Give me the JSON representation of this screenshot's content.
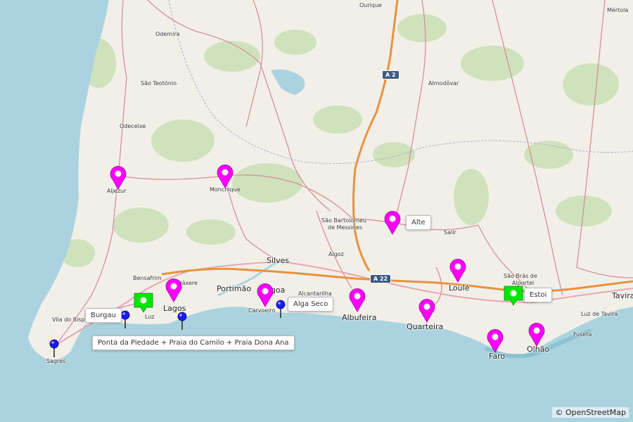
{
  "map": {
    "attribution": "© OpenStreetMap",
    "colors": {
      "sea": "#aad3df",
      "land": "#f2efe9",
      "forest": "#c8e0b3",
      "motorway": "#e8923c",
      "road": "#d68f9c",
      "marker_magenta": "#ff00ff",
      "marker_green": "#00e600",
      "marker_blue": "#1a1aff"
    },
    "towns": [
      {
        "id": "ourique",
        "name": "Ourique"
      },
      {
        "id": "mertola",
        "name": "Mértola"
      },
      {
        "id": "odemira",
        "name": "Odemira"
      },
      {
        "id": "saoteotonio",
        "name": "São Teotónio"
      },
      {
        "id": "almodovar",
        "name": "Almodôvar"
      },
      {
        "id": "odeceixe",
        "name": "Odeceixe"
      },
      {
        "id": "aljezur",
        "name": "Aljezur"
      },
      {
        "id": "monchique",
        "name": "Monchique"
      },
      {
        "id": "saobart1",
        "name": "São Bartolomeu"
      },
      {
        "id": "saobart2",
        "name": "de Messines"
      },
      {
        "id": "salir",
        "name": "Salir"
      },
      {
        "id": "silves",
        "name": "Silves"
      },
      {
        "id": "algoz",
        "name": "Algoz"
      },
      {
        "id": "saobras1",
        "name": "São Brás de"
      },
      {
        "id": "saobras2",
        "name": "Alportel"
      },
      {
        "id": "tavira",
        "name": "Tavira"
      },
      {
        "id": "bensafrim",
        "name": "Bensafrim"
      },
      {
        "id": "odiaxere",
        "name": "Odiáxere"
      },
      {
        "id": "portimao",
        "name": "Portimão"
      },
      {
        "id": "lagoa",
        "name": "Lagoa"
      },
      {
        "id": "alcantarilha",
        "name": "Alcantarilha"
      },
      {
        "id": "loule",
        "name": "Loulé"
      },
      {
        "id": "lagos",
        "name": "Lagos"
      },
      {
        "id": "luz",
        "name": "Luz"
      },
      {
        "id": "vilabispo",
        "name": "Vila do Bispo"
      },
      {
        "id": "carvoeiro",
        "name": "Carvoeiro"
      },
      {
        "id": "albufeira",
        "name": "Albufeira"
      },
      {
        "id": "quarteira",
        "name": "Quarteira"
      },
      {
        "id": "luzdetavira",
        "name": "Luz de Tavira"
      },
      {
        "id": "fuseta",
        "name": "Fuseta"
      },
      {
        "id": "sagres",
        "name": "Sagres"
      },
      {
        "id": "faro",
        "name": "Faro"
      },
      {
        "id": "olhao",
        "name": "Olhão"
      }
    ],
    "road_shields": [
      {
        "id": "a2",
        "label": "A 2"
      },
      {
        "id": "a22",
        "label": "A 22"
      }
    ],
    "callouts": [
      {
        "id": "alte",
        "label": "Alte"
      },
      {
        "id": "estoi",
        "label": "Estoi"
      },
      {
        "id": "burgau",
        "label": "Burgau"
      },
      {
        "id": "algaseco",
        "label": "Alga Seco"
      },
      {
        "id": "ponta",
        "label": "Ponta da Piedade + Praia do Camilo + Praia Dona Ana"
      }
    ]
  }
}
